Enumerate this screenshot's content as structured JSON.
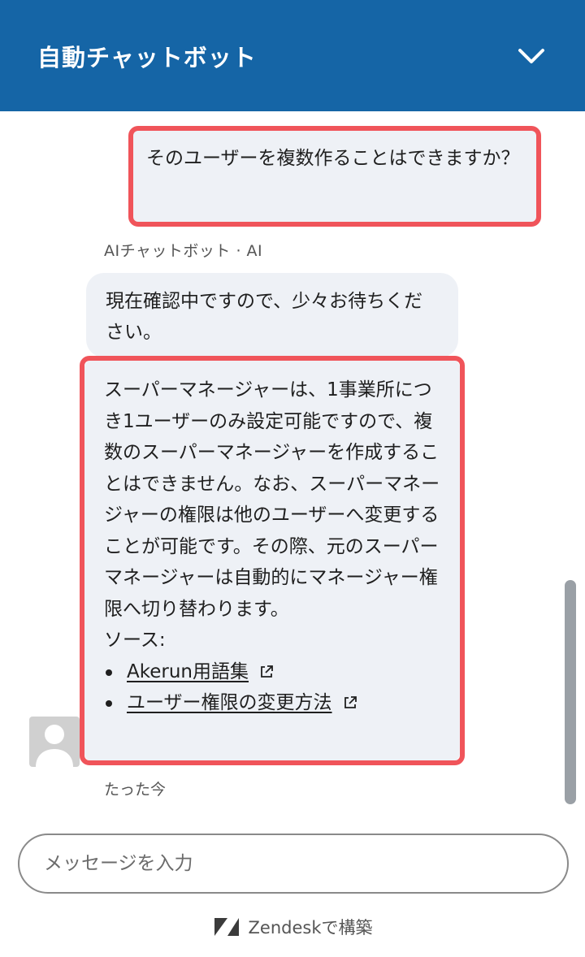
{
  "header": {
    "title": "自動チャットボット"
  },
  "messages": {
    "user_message": "そのユーザーを複数作ることはできますか？",
    "bot_sender": "AIチャットボット · AI",
    "bot_message_1": "現在確認中ですので、少々お待ちください。",
    "bot_message_2": "スーパーマネージャーは、1事業所につき1ユーザーのみ設定可能ですので、複数のスーパーマネージャーを作成することはできません。なお、スーパーマネージャーの権限は他のユーザーへ変更することが可能です。その際、元のスーパーマネージャーは自動的にマネージャー権限へ切り替わります。",
    "sources_label": "ソース:",
    "sources": [
      {
        "label": "Akerun用語集"
      },
      {
        "label": "ユーザー権限の変更方法"
      }
    ],
    "timestamp": "たった今"
  },
  "input": {
    "placeholder": "メッセージを入力",
    "value": ""
  },
  "footer": {
    "text": "Zendeskで構築"
  },
  "colors": {
    "header_bg": "#1565a6",
    "bubble_bg": "#eef1f6",
    "highlight": "#f0545a"
  },
  "icons": {
    "header_toggle": "chevron-down-icon",
    "avatar": "person-icon",
    "source_link": "external-link-icon",
    "footer_brand": "zendesk-logo-icon"
  }
}
